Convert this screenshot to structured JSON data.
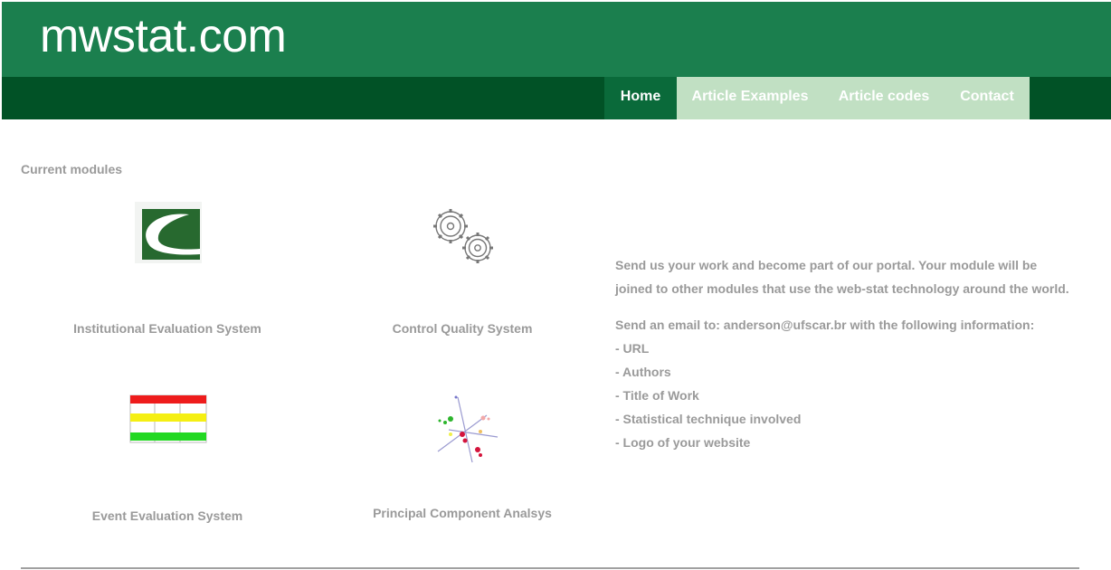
{
  "site": {
    "title": "mwstat.com"
  },
  "nav": {
    "items": [
      {
        "label": "Home"
      },
      {
        "label": "Article Examples"
      },
      {
        "label": "Article codes"
      },
      {
        "label": "Contact"
      }
    ]
  },
  "colors": {
    "header": "#1b7f4e",
    "navbar": "#015226",
    "nav_active": "#0a6a3a",
    "nav_light": "#c1e0c3",
    "text_grey": "#9a9a9a"
  },
  "modules": {
    "title": "Current modules",
    "items": [
      {
        "label": "Institutional Evaluation System",
        "icon": "institutional-logo-icon"
      },
      {
        "label": "Control Quality System",
        "icon": "gears-icon"
      },
      {
        "label": "Event Evaluation System",
        "icon": "traffic-bars-icon"
      },
      {
        "label": "Principal Component Analsys",
        "icon": "pca-scatter-icon"
      }
    ]
  },
  "info": {
    "intro_line1": "Send us your work and become part of our portal. Your module will be",
    "intro_line2": "joined to other modules that use the web-stat technology around the world.",
    "email_line": "Send an email to: anderson@ufscar.br with the following information:",
    "list": [
      "- URL",
      "- Authors",
      "- Title of Work",
      "- Statistical technique involved",
      "- Logo of your website"
    ]
  }
}
